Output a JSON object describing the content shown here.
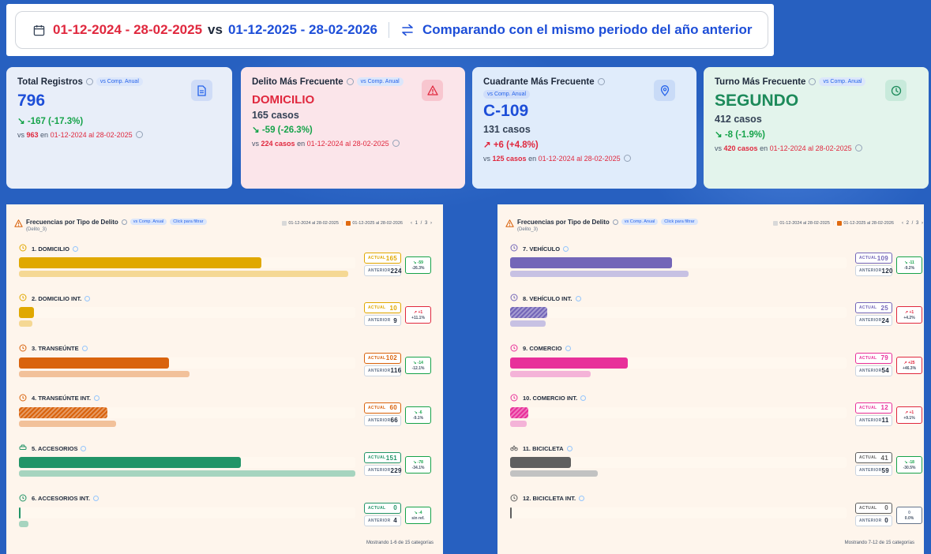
{
  "header": {
    "date_current": "01-12-2024 - 28-02-2025",
    "vs": "vs",
    "date_compare": "01-12-2025 - 28-02-2026",
    "compare_label": "Comparando con el mismo periodo del año anterior"
  },
  "cards": [
    {
      "title": "Total Registros",
      "badge": "vs Comp. Anual",
      "big": "796",
      "sub": "",
      "delta": "-167 (-17.3%)",
      "foot_pre": "vs ",
      "foot_val": "963",
      "foot_mid": " en ",
      "foot_date": "01-12-2024 al 28-02-2025",
      "icon": "document-icon"
    },
    {
      "title": "Delito Más Frecuente",
      "badge": "vs Comp. Anual",
      "big": "DOMICILIO",
      "sub": "165 casos",
      "delta": "-59 (-26.3%)",
      "foot_pre": "vs ",
      "foot_val": "224 casos",
      "foot_mid": " en ",
      "foot_date": "01-12-2024 al 28-02-2025",
      "icon": "warning-icon"
    },
    {
      "title": "Cuadrante Más Frecuente",
      "badge": "vs Comp. Anual",
      "big": "C-109",
      "sub": "131 casos",
      "delta": "+6 (+4.8%)",
      "foot_pre": "vs ",
      "foot_val": "125 casos",
      "foot_mid": " en ",
      "foot_date": "01-12-2024 al 28-02-2025",
      "icon": "location-pin-icon"
    },
    {
      "title": "Turno Más Frecuente",
      "badge": "vs Comp. Anual",
      "big": "SEGUNDO",
      "sub": "412 casos",
      "delta": "-8 (-1.9%)",
      "foot_pre": "vs ",
      "foot_val": "420 casos",
      "foot_mid": " en ",
      "foot_date": "01-12-2024 al 28-02-2025",
      "icon": "clock-icon"
    }
  ],
  "colors": {
    "increase": "#e0283e",
    "decrease": "#16a34a",
    "neutral": "#64748b"
  },
  "panels": [
    {
      "title": "Frecuencias por Tipo de Delito",
      "badge1": "vs Comp. Anual",
      "badge2": "Click para filtrar",
      "subtitle": "(Delito_3)",
      "legend_prev": "01-12-2024 al 28-02-2025",
      "legend_cur": "01-12-2025 al 28-02-2026",
      "page": "1 / 3",
      "footer": "Mostrando 1-6 de 15 categorías",
      "items": [
        {
          "label": "1. DOMICILIO",
          "actual_label": "ACTUAL",
          "actual": "165",
          "anterior_label": "ANTERIOR",
          "anterior": "224",
          "d1": "-59",
          "d2": "-26.3%",
          "cur": 165,
          "prev": 224,
          "color": "#e0a800",
          "prevColor": "#f5d894",
          "dir": "down",
          "icon": "clock-icon",
          "hatch": false
        },
        {
          "label": "2. DOMICILIO INT.",
          "actual_label": "ACTUAL",
          "actual": "10",
          "anterior_label": "ANTERIOR",
          "anterior": "9",
          "d1": "+1",
          "d2": "+11.1%",
          "cur": 10,
          "prev": 9,
          "color": "#e0a800",
          "prevColor": "#f5d894",
          "dir": "up",
          "icon": "clock-icon",
          "hatch": false
        },
        {
          "label": "3. TRANSEÚNTE",
          "actual_label": "ACTUAL",
          "actual": "102",
          "anterior_label": "ANTERIOR",
          "anterior": "116",
          "d1": "-14",
          "d2": "-12.1%",
          "cur": 102,
          "prev": 116,
          "color": "#d9630d",
          "prevColor": "#f2c19a",
          "dir": "down",
          "icon": "clock-icon",
          "hatch": false
        },
        {
          "label": "4. TRANSEÚNTE INT.",
          "actual_label": "ACTUAL",
          "actual": "60",
          "anterior_label": "ANTERIOR",
          "anterior": "66",
          "d1": "-6",
          "d2": "-9.1%",
          "cur": 60,
          "prev": 66,
          "color": "#d9630d",
          "prevColor": "#f2c19a",
          "dir": "down",
          "icon": "clock-icon",
          "hatch": true
        },
        {
          "label": "5. ACCESORIOS",
          "actual_label": "ACTUAL",
          "actual": "151",
          "anterior_label": "ANTERIOR",
          "anterior": "229",
          "d1": "-78",
          "d2": "-34.1%",
          "cur": 151,
          "prev": 229,
          "color": "#219467",
          "prevColor": "#a6d4bf",
          "dir": "down",
          "icon": "car-icon",
          "hatch": false
        },
        {
          "label": "6. ACCESORIOS INT.",
          "actual_label": "ACTUAL",
          "actual": "0",
          "anterior_label": "ANTERIOR",
          "anterior": "4",
          "d1": "-4",
          "d2": "sin ref.",
          "cur": 0,
          "prev": 4,
          "color": "#219467",
          "prevColor": "#a6d4bf",
          "dir": "down",
          "icon": "clock-icon",
          "hatch": false
        }
      ]
    },
    {
      "title": "Frecuencias por Tipo de Delito",
      "badge1": "vs Comp. Anual",
      "badge2": "Click para filtrar",
      "subtitle": "(Delito_3)",
      "legend_prev": "01-12-2024 al 28-02-2025",
      "legend_cur": "01-12-2025 al 28-02-2026",
      "page": "2 / 3",
      "footer": "Mostrando 7-12 de 15 categorías",
      "items": [
        {
          "label": "7. VEHÍCULO",
          "actual_label": "ACTUAL",
          "actual": "109",
          "anterior_label": "ANTERIOR",
          "anterior": "120",
          "d1": "-11",
          "d2": "-9.2%",
          "cur": 109,
          "prev": 120,
          "color": "#7366b8",
          "prevColor": "#c7c1e3",
          "dir": "down",
          "icon": "clock-icon",
          "hatch": false
        },
        {
          "label": "8. VEHÍCULO INT.",
          "actual_label": "ACTUAL",
          "actual": "25",
          "anterior_label": "ANTERIOR",
          "anterior": "24",
          "d1": "+1",
          "d2": "+4.2%",
          "cur": 25,
          "prev": 24,
          "color": "#7366b8",
          "prevColor": "#c7c1e3",
          "dir": "up",
          "icon": "clock-icon",
          "hatch": true
        },
        {
          "label": "9. COMERCIO",
          "actual_label": "ACTUAL",
          "actual": "79",
          "anterior_label": "ANTERIOR",
          "anterior": "54",
          "d1": "+25",
          "d2": "+46.3%",
          "cur": 79,
          "prev": 54,
          "color": "#e8309a",
          "prevColor": "#f4b3d8",
          "dir": "up",
          "icon": "clock-icon",
          "hatch": false
        },
        {
          "label": "10. COMERCIO INT.",
          "actual_label": "ACTUAL",
          "actual": "12",
          "anterior_label": "ANTERIOR",
          "anterior": "11",
          "d1": "+1",
          "d2": "+9.1%",
          "cur": 12,
          "prev": 11,
          "color": "#e8309a",
          "prevColor": "#f4b3d8",
          "dir": "up",
          "icon": "clock-icon",
          "hatch": true
        },
        {
          "label": "11. BICICLETA",
          "actual_label": "ACTUAL",
          "actual": "41",
          "anterior_label": "ANTERIOR",
          "anterior": "59",
          "d1": "-18",
          "d2": "-30.5%",
          "cur": 41,
          "prev": 59,
          "color": "#5f5f5f",
          "prevColor": "#c2c2c2",
          "dir": "down",
          "icon": "bicycle-icon",
          "hatch": false
        },
        {
          "label": "12. BICICLETA INT.",
          "actual_label": "ACTUAL",
          "actual": "0",
          "anterior_label": "ANTERIOR",
          "anterior": "0",
          "d1": "0",
          "d2": "0.0%",
          "cur": 0,
          "prev": 0,
          "color": "#5f5f5f",
          "prevColor": "#c2c2c2",
          "dir": "flat",
          "icon": "clock-icon",
          "hatch": false
        }
      ]
    }
  ]
}
